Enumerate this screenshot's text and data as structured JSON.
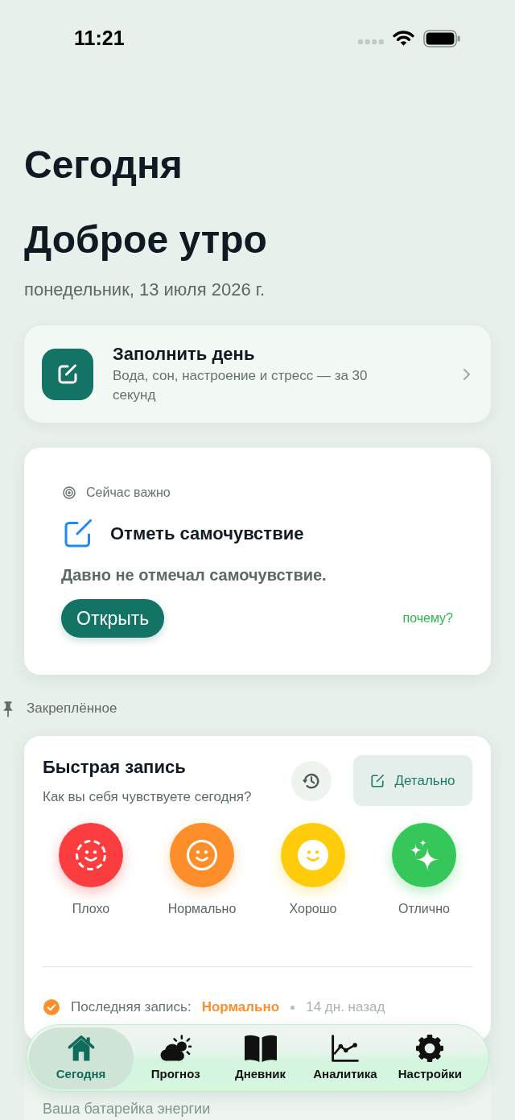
{
  "status_bar": {
    "time": "11:21"
  },
  "header": {
    "title": "Сегодня",
    "greeting": "Доброе утро",
    "date": "понедельник, 13 июля 2026 г."
  },
  "fill_day_card": {
    "title": "Заполнить день",
    "subtitle": "Вода, сон, настроение и стресс — за 30 секунд"
  },
  "important_card": {
    "label": "Сейчас важно",
    "title": "Отметь самочувствие",
    "message": "Давно не отмечал самочувствие.",
    "button": "Открыть",
    "link": "почему?"
  },
  "pinned": {
    "label": "Закреплённое"
  },
  "quick_entry": {
    "title": "Быстрая запись",
    "question": "Как вы себя чувствуете сегодня?",
    "detail_button": "Детально",
    "moods": [
      {
        "label": "Плохо",
        "kind": "bad",
        "color": "#fc3d3f"
      },
      {
        "label": "Нормально",
        "kind": "normal",
        "color": "#fd8e2a"
      },
      {
        "label": "Хорошо",
        "kind": "good",
        "color": "#fecc0a"
      },
      {
        "label": "Отлично",
        "kind": "excellent",
        "color": "#35c759"
      }
    ],
    "last_entry": {
      "label": "Последняя запись:",
      "value": "Нормально",
      "time": "14 дн. назад"
    }
  },
  "energy_card": {
    "text": "Ваша батарейка энергии"
  },
  "tab_bar": {
    "tabs": [
      {
        "label": "Сегодня",
        "kind": "home",
        "selected": true
      },
      {
        "label": "Прогноз",
        "kind": "forecast",
        "selected": false
      },
      {
        "label": "Дневник",
        "kind": "diary",
        "selected": false
      },
      {
        "label": "Аналитика",
        "kind": "analytics",
        "selected": false
      },
      {
        "label": "Настройки",
        "kind": "settings",
        "selected": false
      }
    ]
  }
}
